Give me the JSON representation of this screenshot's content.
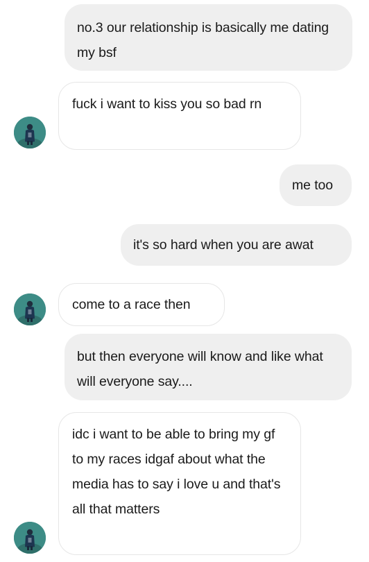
{
  "thread": {
    "messages": [
      {
        "id": "m1",
        "direction": "sent",
        "text": "no.3 our relationship is basically me dating my bsf"
      },
      {
        "id": "m2",
        "direction": "received",
        "text": "fuck i want to kiss you so bad rn"
      },
      {
        "id": "m3",
        "direction": "sent",
        "text": "me too"
      },
      {
        "id": "m4",
        "direction": "sent",
        "text": "it's so hard when you are awat"
      },
      {
        "id": "m5",
        "direction": "received",
        "text": "come to a race then"
      },
      {
        "id": "m6",
        "direction": "sent",
        "text": "but then everyone will know and like what will everyone say...."
      },
      {
        "id": "m7",
        "direction": "received",
        "text": "idc i want to be able to bring my gf to my races idgaf about what the media has to say i love u and that's all that matters"
      }
    ]
  },
  "colors": {
    "sent_bubble": "#efefef",
    "received_bubble": "#ffffff",
    "received_border": "#e6e6e6",
    "avatar_bg": "#3d8c86"
  },
  "icons": {
    "avatar": "profile-photo-avatar"
  }
}
